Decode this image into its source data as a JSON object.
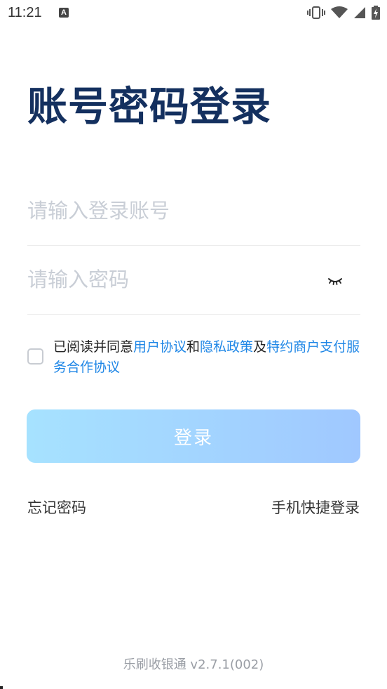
{
  "status_bar": {
    "time": "11:21",
    "notification_icon": "A",
    "icons": [
      "vibrate-icon",
      "wifi-icon",
      "signal-icon",
      "battery-charging-icon"
    ]
  },
  "title": "账号密码登录",
  "account_field": {
    "placeholder": "请输入登录账号",
    "value": ""
  },
  "password_field": {
    "placeholder": "请输入密码",
    "value": "",
    "toggle_icon": "eye-closed-icon"
  },
  "agreement": {
    "checked": false,
    "prefix": "已阅读并同意",
    "user_agreement": "用户协议",
    "and": "和",
    "privacy_policy": "隐私政策",
    "and2": "及",
    "merchant_agreement": "特约商户支付服务合作协议"
  },
  "login_button": "登录",
  "forgot_password": "忘记密码",
  "quick_login": "手机快捷登录",
  "version": "乐刷收银通 v2.7.1(002)",
  "colors": {
    "title": "#14305f",
    "link": "#1e86e6",
    "button_gradient_start": "#a6e2ff",
    "button_gradient_end": "#a0c8ff"
  }
}
